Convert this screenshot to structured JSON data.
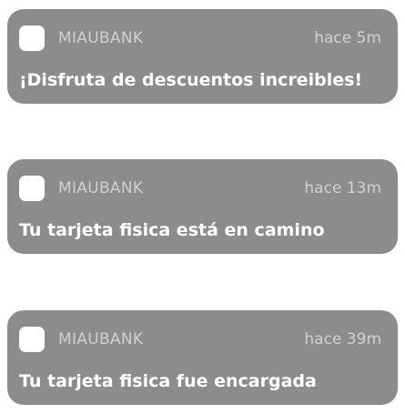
{
  "colors": {
    "card_background": "#8c8c8c",
    "app_icon": "#ffffff",
    "secondary_text": "#d0d0d0",
    "message_text": "#ffffff"
  },
  "notifications": [
    {
      "app_name": "MIAUBANK",
      "time": "hace 5m",
      "message": "¡Disfruta de descuentos increibles!",
      "icon": "app-icon-placeholder"
    },
    {
      "app_name": "MIAUBANK",
      "time": "hace 13m",
      "message": "Tu tarjeta fisica está en camino",
      "icon": "app-icon-placeholder"
    },
    {
      "app_name": "MIAUBANK",
      "time": "hace 39m",
      "message": "Tu tarjeta fisica fue encargada",
      "icon": "app-icon-placeholder"
    }
  ]
}
